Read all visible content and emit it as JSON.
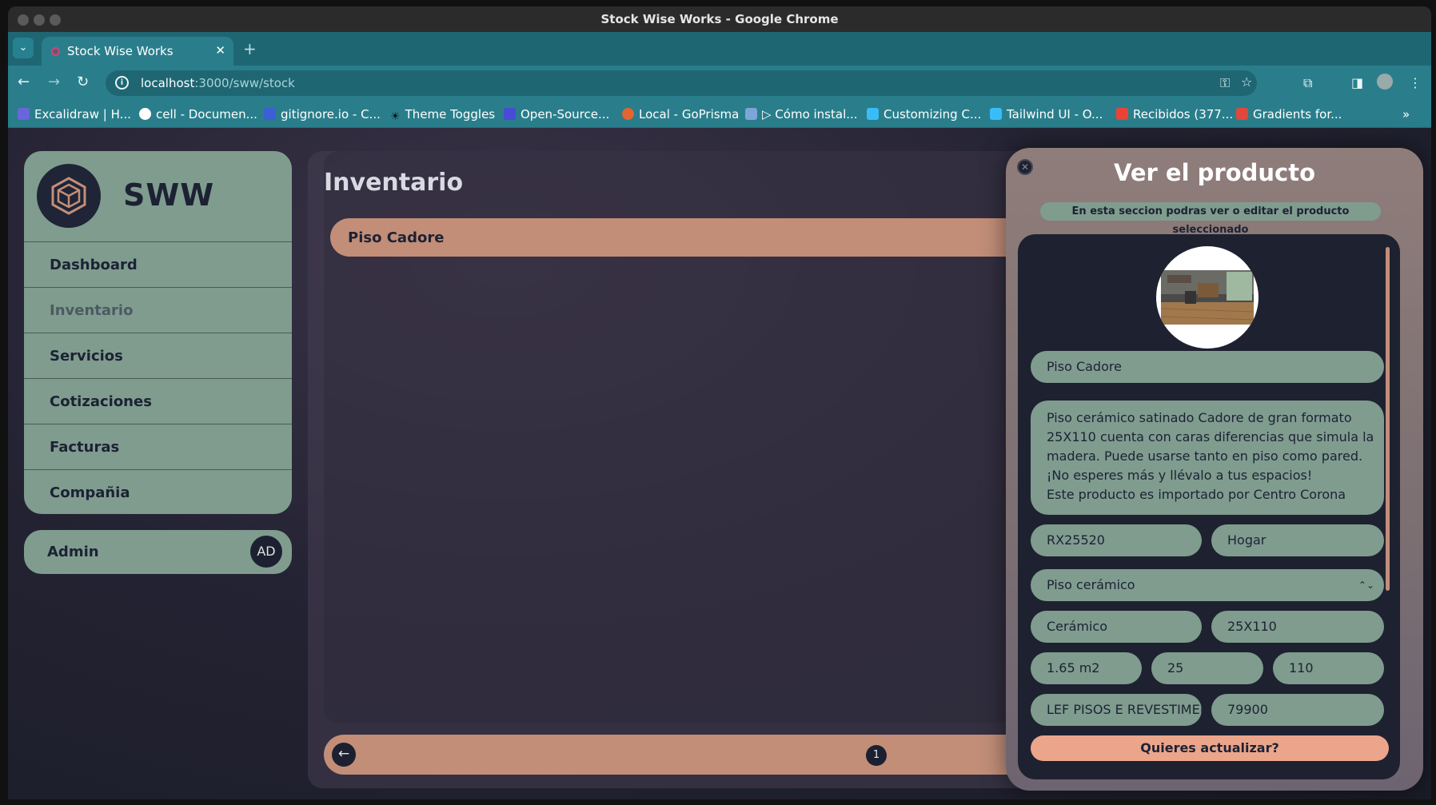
{
  "window": {
    "title": "Stock Wise Works - Google Chrome"
  },
  "browser": {
    "tab_title": "Stock Wise Works",
    "url_host": "localhost",
    "url_path": ":3000/sww/stock",
    "bookmarks": [
      "Excalidraw | H...",
      "cell - Documen...",
      "gitignore.io - C...",
      "Theme Toggles",
      "Open-Source...",
      "Local - GoPrisma",
      "▷ Cómo instal...",
      "Customizing C...",
      "Tailwind UI - O...",
      "Recibidos (377...",
      "Gradients for..."
    ]
  },
  "sidebar": {
    "brand": "SWW",
    "items": [
      "Dashboard",
      "Inventario",
      "Servicios",
      "Cotizaciones",
      "Facturas",
      "Compañia"
    ],
    "active": "Inventario"
  },
  "user": {
    "name": "Admin",
    "initials": "AD"
  },
  "main": {
    "title": "Inventario",
    "products": [
      "Piso Cadore"
    ],
    "page": "1"
  },
  "modal": {
    "title": "Ver el producto",
    "subtitle": "En esta seccion podras ver o editar el producto seleccionado",
    "name": "Piso Cadore",
    "description": "Piso cerámico satinado Cadore de gran formato 25X110 cuenta con caras diferencias que simula la madera. Puede usarse tanto en piso como pared. ¡No esperes más y llévalo a tus espacios!\nEste producto es importado por Centro Corona",
    "code": "RX25520",
    "category": "Hogar",
    "type": "Piso cerámico",
    "material": "Cerámico",
    "format": "25X110",
    "area": "1.65 m2",
    "width": "25",
    "length": "110",
    "supplier": "LEF PISOS E REVESTIMENT",
    "price": "79900",
    "update_label": "Quieres actualizar?"
  },
  "colors": {
    "sage": "#7f9c8f",
    "terracotta": "#c28e78",
    "peach": "#eba58b",
    "navy": "#1e2130",
    "teal": "#2a7e8b"
  }
}
